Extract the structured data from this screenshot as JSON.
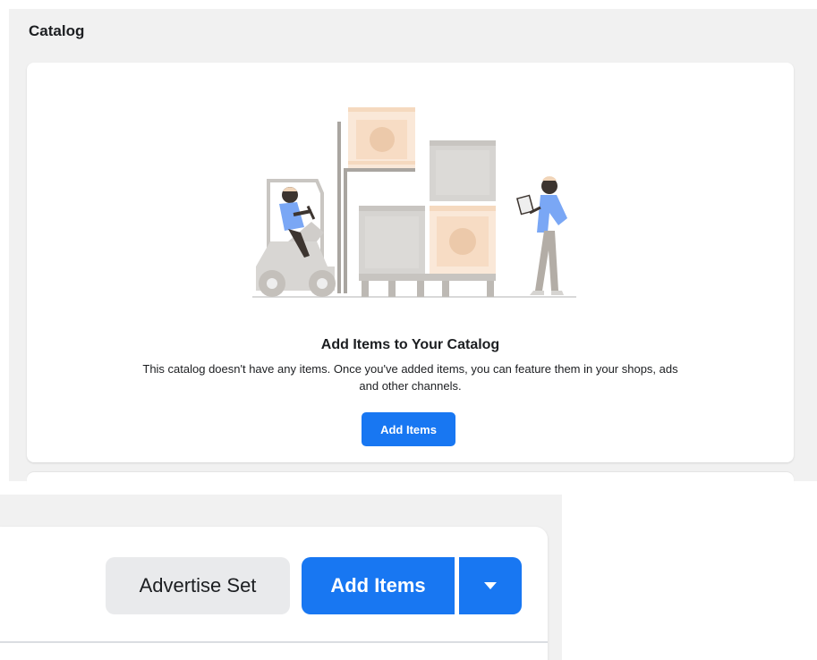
{
  "catalog": {
    "title": "Catalog",
    "empty_state": {
      "heading": "Add Items to Your Catalog",
      "description": "This catalog doesn't have any items. Once you've added items, you can feature them in your shops, ads and other channels.",
      "add_button_label": "Add Items"
    }
  },
  "toolbar": {
    "advertise_set_label": "Advertise Set",
    "add_items_label": "Add Items",
    "dropdown_icon": "caret-down-icon"
  },
  "colors": {
    "primary": "#1877f2",
    "secondary_button": "#e9eaec",
    "page_background": "#f1f1f1",
    "box_light": "#fae8d8",
    "box_accent": "#ecc9aa",
    "pallet_gray": "#d5d3d0",
    "figure_blue": "#7aa7f5"
  }
}
